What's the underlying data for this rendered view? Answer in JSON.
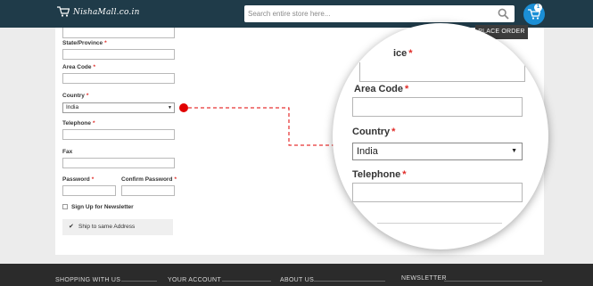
{
  "header": {
    "logo_text": "NishaMall.co.in",
    "search_placeholder": "Search entire store here...",
    "cart_count": "1"
  },
  "place_order_label": "PLACE ORDER",
  "form": {
    "state_label": "State/Province",
    "area_code_label": "Area Code",
    "country_label": "Country",
    "country_value": "India",
    "telephone_label": "Telephone",
    "fax_label": "Fax",
    "password_label": "Password",
    "confirm_password_label": "Confirm Password",
    "required_mark": "*",
    "newsletter_label": "Sign Up for Newsletter",
    "ship_label": "Ship to same Address"
  },
  "magnifier": {
    "top_label": "ice",
    "area_code_label": "Area Code",
    "country_label": "Country",
    "country_value": "India",
    "telephone_label": "Telephone"
  },
  "footer": {
    "sections": [
      "SHOPPING WITH US",
      "YOUR ACCOUNT",
      "ABOUT US",
      "NEWSLETTER"
    ]
  },
  "colors": {
    "header_bg": "#1f3b49",
    "cart_blue": "#1b8fd6",
    "required_red": "#e02b27",
    "connector_red": "#e10000",
    "footer_bg": "#2b2b2b"
  },
  "icons": [
    "cart-logo-icon",
    "search-icon",
    "cart-icon",
    "chevron-down-icon",
    "checkmark-icon"
  ]
}
